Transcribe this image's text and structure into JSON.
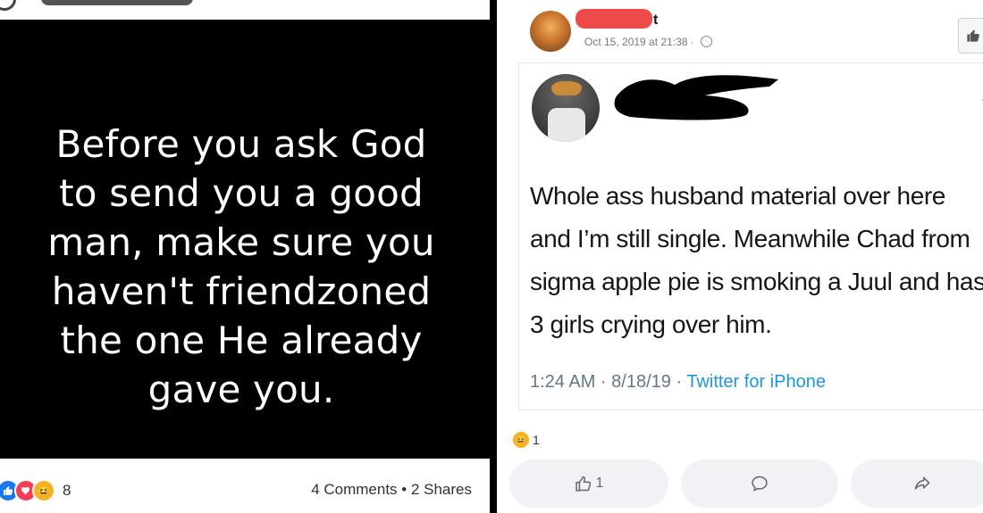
{
  "left": {
    "quote_lines": [
      "Before you ask God",
      "to send you a good",
      "man, make sure you",
      "haven't friendzoned",
      "the one He already",
      "gave you."
    ],
    "reaction_count": "8",
    "stats": "4 Comments • 2 Shares"
  },
  "right": {
    "header": {
      "name_suffix": "t",
      "timestamp": "Oct 15, 2019 at 21:38 ·"
    },
    "tweet": {
      "text": "Whole ass husband material over here and I’m still single. Meanwhile Chad from sigma apple pie is smoking a Juul and has 3 girls crying over him.",
      "time": "1:24 AM · 8/18/19 ·",
      "source": "Twitter for iPhone"
    },
    "reaction_count": "1",
    "like_count": "1"
  },
  "colors": {
    "facebook_blue": "#1877f2",
    "twitter_blue": "#1b95e0",
    "haha_yellow": "#f7b125",
    "redaction": "#000000"
  },
  "icons": [
    "like-icon",
    "love-icon",
    "haha-icon",
    "globe-icon",
    "thumbs-up-icon",
    "comment-icon",
    "share-icon",
    "chevron-down-icon"
  ]
}
